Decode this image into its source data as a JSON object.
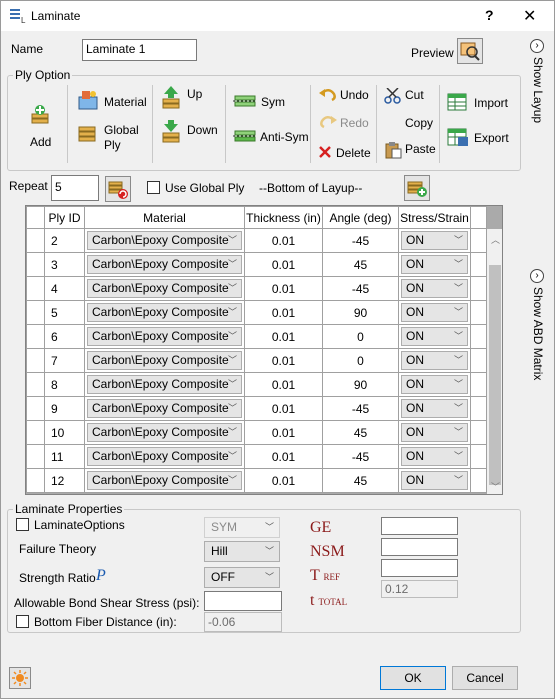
{
  "window": {
    "title": "Laminate",
    "help": "?",
    "close": "✕"
  },
  "name": {
    "label": "Name",
    "value": "Laminate 1",
    "preview_label": "Preview"
  },
  "side_panels": {
    "layup": "Show Layup",
    "abd": "Show ABD Matrix"
  },
  "ply_option": {
    "title": "Ply Option",
    "add": "Add",
    "material": "Material",
    "global_ply": "Global Ply",
    "up": "Up",
    "down": "Down",
    "sym": "Sym",
    "anti_sym": "Anti-Sym",
    "undo": "Undo",
    "redo": "Redo",
    "delete": "Delete",
    "cut": "Cut",
    "copy": "Copy",
    "paste": "Paste",
    "import": "Import",
    "export": "Export"
  },
  "repeat": {
    "label": "Repeat",
    "value": "5",
    "use_global_ply": "Use Global Ply",
    "bottom_text": "--Bottom of Layup--"
  },
  "table": {
    "columns": [
      "Ply ID",
      "Material",
      "Thickness (in)",
      "Angle (deg)",
      "Stress/Strain"
    ],
    "rows": [
      {
        "id": "2",
        "material": "Carbon\\Epoxy Composite",
        "thickness": "0.01",
        "angle": "-45",
        "ss": "ON"
      },
      {
        "id": "3",
        "material": "Carbon\\Epoxy Composite",
        "thickness": "0.01",
        "angle": "45",
        "ss": "ON"
      },
      {
        "id": "4",
        "material": "Carbon\\Epoxy Composite",
        "thickness": "0.01",
        "angle": "-45",
        "ss": "ON"
      },
      {
        "id": "5",
        "material": "Carbon\\Epoxy Composite",
        "thickness": "0.01",
        "angle": "90",
        "ss": "ON"
      },
      {
        "id": "6",
        "material": "Carbon\\Epoxy Composite",
        "thickness": "0.01",
        "angle": "0",
        "ss": "ON"
      },
      {
        "id": "7",
        "material": "Carbon\\Epoxy Composite",
        "thickness": "0.01",
        "angle": "0",
        "ss": "ON"
      },
      {
        "id": "8",
        "material": "Carbon\\Epoxy Composite",
        "thickness": "0.01",
        "angle": "90",
        "ss": "ON"
      },
      {
        "id": "9",
        "material": "Carbon\\Epoxy Composite",
        "thickness": "0.01",
        "angle": "-45",
        "ss": "ON"
      },
      {
        "id": "10",
        "material": "Carbon\\Epoxy Composite",
        "thickness": "0.01",
        "angle": "45",
        "ss": "ON"
      },
      {
        "id": "11",
        "material": "Carbon\\Epoxy Composite",
        "thickness": "0.01",
        "angle": "-45",
        "ss": "ON"
      },
      {
        "id": "12",
        "material": "Carbon\\Epoxy Composite",
        "thickness": "0.01",
        "angle": "45",
        "ss": "ON"
      }
    ]
  },
  "props": {
    "title": "Laminate Properties",
    "laminate_options": "LaminateOptions",
    "sym_value": "SYM",
    "failure_theory_label": "Failure Theory",
    "failure_theory_value": "Hill",
    "strength_ratio_label": "Strength Ratio",
    "strength_ratio_value": "OFF",
    "bond_label": "Allowable Bond Shear Stress (psi):",
    "bond_value": "",
    "bottom_fiber_label": "Bottom Fiber Distance (in):",
    "bottom_fiber_value": "-0.06",
    "ge_label": "GE",
    "nsm_label": "NSM",
    "tref_label": "T",
    "tref_sub": "REF",
    "ttotal_label": "t",
    "ttotal_sub": "TOTAL",
    "ge_value": "",
    "nsm_value": "",
    "tref_value": "",
    "ttotal_value": "0.12"
  },
  "buttons": {
    "ok": "OK",
    "cancel": "Cancel"
  }
}
